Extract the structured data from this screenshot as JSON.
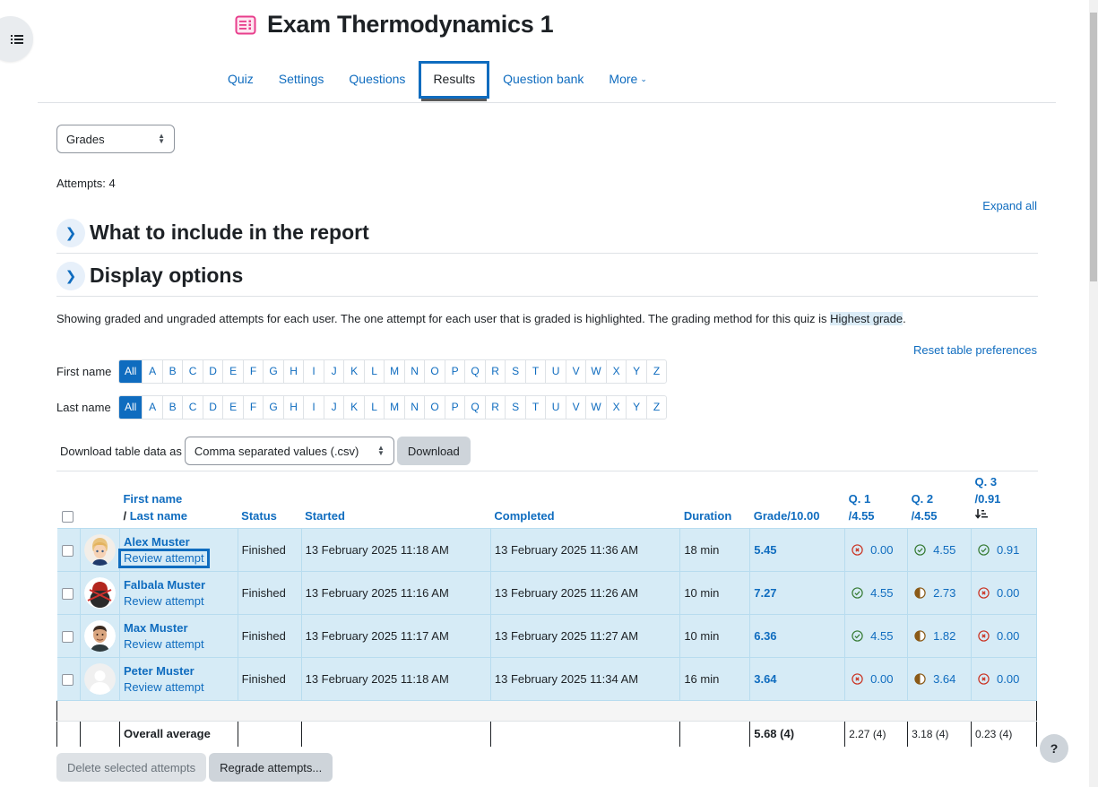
{
  "page": {
    "title": "Exam Thermodynamics 1",
    "icon": "quiz-icon"
  },
  "nav": {
    "tabs": [
      {
        "label": "Quiz",
        "active": false
      },
      {
        "label": "Settings",
        "active": false
      },
      {
        "label": "Questions",
        "active": false
      },
      {
        "label": "Results",
        "active": true
      },
      {
        "label": "Question bank",
        "active": false
      },
      {
        "label": "More",
        "active": false,
        "has_dropdown": true
      }
    ]
  },
  "report_select": {
    "selected": "Grades"
  },
  "attempts_label": "Attempts: 4",
  "expand_all": "Expand all",
  "sections": [
    {
      "title": "What to include in the report",
      "expanded": false
    },
    {
      "title": "Display options",
      "expanded": false
    }
  ],
  "info": {
    "text_before": "Showing graded and ungraded attempts for each user. The one attempt for each user that is graded is highlighted. The grading method for this quiz is ",
    "highlight": "Highest grade",
    "text_after": "."
  },
  "reset_prefs": "Reset table preferences",
  "initials": {
    "first_label": "First name",
    "last_label": "Last name",
    "all": "All",
    "letters": [
      "A",
      "B",
      "C",
      "D",
      "E",
      "F",
      "G",
      "H",
      "I",
      "J",
      "K",
      "L",
      "M",
      "N",
      "O",
      "P",
      "Q",
      "R",
      "S",
      "T",
      "U",
      "V",
      "W",
      "X",
      "Y",
      "Z"
    ],
    "first_selected": "All",
    "last_selected": "All"
  },
  "download": {
    "label": "Download table data as",
    "format": "Comma separated values (.csv)",
    "button": "Download"
  },
  "table": {
    "headers": {
      "first_name": "First name",
      "last_name_sep": "/ ",
      "last_name": "Last name",
      "status": "Status",
      "started": "Started",
      "completed": "Completed",
      "duration": "Duration",
      "grade": "Grade/10.00",
      "q1_a": "Q. 1",
      "q1_b": "/4.55",
      "q2_a": "Q. 2",
      "q2_b": "/4.55",
      "q3_a": "Q. 3",
      "q3_b": "/0.91",
      "q3_sort": "sort-descending-icon"
    },
    "rows": [
      {
        "name": "Alex Muster",
        "review": "Review attempt",
        "avatar": "cartoon-boy",
        "status": "Finished",
        "started": "13 February 2025 11:18 AM",
        "completed": "13 February 2025 11:36 AM",
        "duration": "18 min",
        "grade": "5.45",
        "q": [
          {
            "state": "incorrect",
            "value": "0.00"
          },
          {
            "state": "correct",
            "value": "4.55"
          },
          {
            "state": "correct",
            "value": "0.91"
          }
        ]
      },
      {
        "name": "Falbala Muster",
        "review": "Review attempt",
        "avatar": "ninja",
        "status": "Finished",
        "started": "13 February 2025 11:16 AM",
        "completed": "13 February 2025 11:26 AM",
        "duration": "10 min",
        "grade": "7.27",
        "q": [
          {
            "state": "correct",
            "value": "4.55"
          },
          {
            "state": "partial",
            "value": "2.73"
          },
          {
            "state": "incorrect",
            "value": "0.00"
          }
        ]
      },
      {
        "name": "Max Muster",
        "review": "Review attempt",
        "avatar": "photo",
        "status": "Finished",
        "started": "13 February 2025 11:17 AM",
        "completed": "13 February 2025 11:27 AM",
        "duration": "10 min",
        "grade": "6.36",
        "q": [
          {
            "state": "correct",
            "value": "4.55"
          },
          {
            "state": "partial",
            "value": "1.82"
          },
          {
            "state": "incorrect",
            "value": "0.00"
          }
        ]
      },
      {
        "name": "Peter Muster",
        "review": "Review attempt",
        "avatar": "default",
        "status": "Finished",
        "started": "13 February 2025 11:18 AM",
        "completed": "13 February 2025 11:34 AM",
        "duration": "16 min",
        "grade": "3.64",
        "q": [
          {
            "state": "incorrect",
            "value": "0.00"
          },
          {
            "state": "partial",
            "value": "3.64"
          },
          {
            "state": "incorrect",
            "value": "0.00"
          }
        ]
      }
    ],
    "average": {
      "label": "Overall average",
      "grade": "5.68 (4)",
      "q1": "2.27 (4)",
      "q2": "3.18 (4)",
      "q3": "0.23 (4)"
    }
  },
  "buttons": {
    "delete": "Delete selected attempts",
    "regrade": "Regrade attempts..."
  },
  "help": "?",
  "colors": {
    "accent": "#0f6cbf",
    "highlight_row": "#d6ebf6",
    "correct": "#357a32",
    "incorrect": "#ca3120",
    "partial": "#8a5a18",
    "quiz_icon": "#e83e8c"
  }
}
